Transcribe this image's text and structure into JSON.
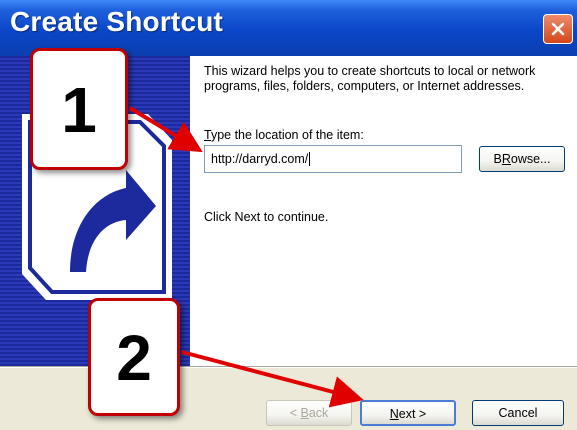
{
  "window": {
    "title": "Create Shortcut"
  },
  "intro_text": "This wizard helps you to create shortcuts to local or network programs, files, folders, computers, or Internet addresses.",
  "location": {
    "label_mnemonic": "T",
    "label_rest": "ype the location of the item:",
    "value": "http://darryd.com/"
  },
  "browse": {
    "mnemonic": "R",
    "pre": "B",
    "rest": "owse..."
  },
  "continue_text": "Click Next to continue.",
  "buttons": {
    "back_pre": "< ",
    "back_mnemonic": "B",
    "back_rest": "ack",
    "next_mnemonic": "N",
    "next_rest": "ext >",
    "cancel": "Cancel"
  },
  "callouts": {
    "step1": "1",
    "step2": "2"
  },
  "colors": {
    "title_bar": "#0a46c8",
    "side_panel": "#1d2a9e",
    "callout_border": "#c00000",
    "arrow": "#e00000"
  },
  "icons": [
    "close-icon",
    "shortcut-arrow-icon"
  ]
}
